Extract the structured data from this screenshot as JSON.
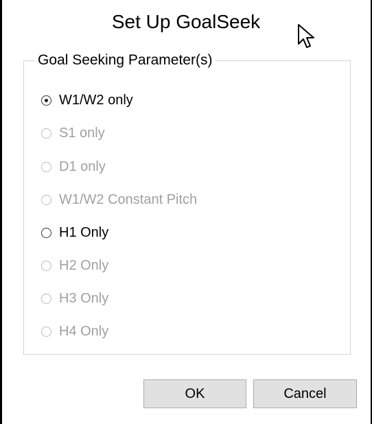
{
  "dialog": {
    "title": "Set Up GoalSeek"
  },
  "group": {
    "legend": "Goal Seeking Parameter(s)",
    "options": [
      {
        "label": "W1/W2 only",
        "selected": true,
        "enabled": true
      },
      {
        "label": "S1 only",
        "selected": false,
        "enabled": false
      },
      {
        "label": "D1 only",
        "selected": false,
        "enabled": false
      },
      {
        "label": "W1/W2 Constant Pitch",
        "selected": false,
        "enabled": false
      },
      {
        "label": "H1 Only",
        "selected": false,
        "enabled": true
      },
      {
        "label": "H2 Only",
        "selected": false,
        "enabled": false
      },
      {
        "label": "H3 Only",
        "selected": false,
        "enabled": false
      },
      {
        "label": "H4 Only",
        "selected": false,
        "enabled": false
      }
    ]
  },
  "buttons": {
    "ok_label": "OK",
    "cancel_label": "Cancel"
  },
  "icons": {
    "cursor": "mouse-pointer-icon"
  },
  "colors": {
    "enabled_text": "#000000",
    "disabled_text": "#a0a0a0",
    "button_face": "#e1e1e1",
    "group_border": "#d5d5d5"
  }
}
